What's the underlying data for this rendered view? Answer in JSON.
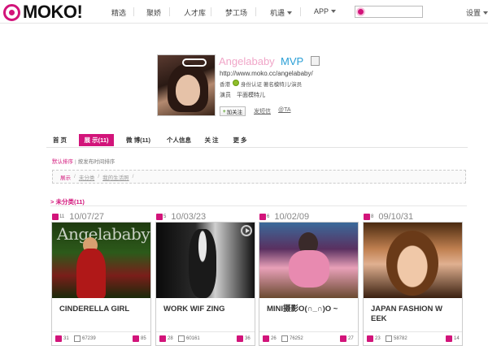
{
  "brand": {
    "logo_text": "MOKO!",
    "accent": "#d2147a"
  },
  "nav": {
    "items": [
      {
        "label": "精选"
      },
      {
        "label": "聚娇"
      },
      {
        "label": "人才库"
      },
      {
        "label": "梦工场"
      },
      {
        "label": "机遇"
      },
      {
        "label": "APP"
      }
    ],
    "search_placeholder": "",
    "settings_label": "设置"
  },
  "profile": {
    "name": "Angelababy",
    "rank": "MVP",
    "url": "http://www.moko.cc/angelababy/",
    "location": "香港",
    "verify_text": "身份认证 著名模特儿/演员",
    "tags": [
      "演员",
      "平面模特儿"
    ],
    "follow_label": "加关注",
    "follow_plus": "+",
    "message_label": "发短信",
    "at_label": "@TA"
  },
  "tabs": [
    {
      "label": "首 页"
    },
    {
      "label": "展 示(11)"
    },
    {
      "label": "微 博(11)"
    },
    {
      "label": "个人信息"
    },
    {
      "label": "关 注"
    },
    {
      "label": "更 多"
    }
  ],
  "sort": {
    "default_label": "默认排序",
    "separator": "|",
    "time_label": "按发布时间排序"
  },
  "breadcrumb": {
    "items": [
      "展示",
      "未分类",
      "我的生活照"
    ],
    "separator": "/"
  },
  "category": {
    "title": "> 未分类(11)"
  },
  "cards": [
    {
      "photo_count": "11",
      "date": "10/07/27",
      "watermark": "Angelababy",
      "title": "CINDERELLA GIRL",
      "likes": "31",
      "views": "67239",
      "comments": "85"
    },
    {
      "photo_count": "5",
      "date": "10/03/23",
      "title": "WORK WIF ZING",
      "likes": "28",
      "views": "60161",
      "comments": "36"
    },
    {
      "photo_count": "6",
      "date": "10/02/09",
      "title": "MINI摄影O(∩_∩)O ~",
      "likes": "26",
      "views": "76252",
      "comments": "27"
    },
    {
      "photo_count": "8",
      "date": "09/10/31",
      "title": "JAPAN FASHION W EEK",
      "likes": "23",
      "views": "58782",
      "comments": "14"
    }
  ]
}
